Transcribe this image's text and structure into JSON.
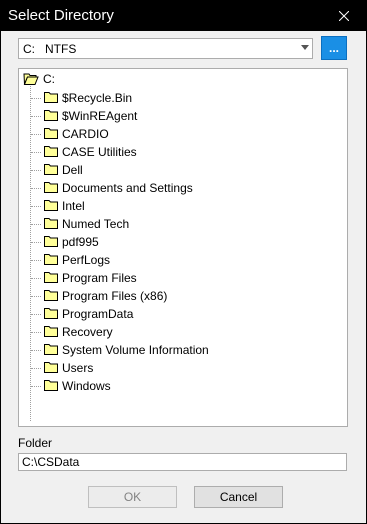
{
  "window": {
    "title": "Select Directory",
    "close_icon": "close-icon"
  },
  "drive": {
    "letter": "C:",
    "filesystem": "NTFS",
    "browse_label": "..."
  },
  "tree": {
    "root": "C:",
    "items": [
      "$Recycle.Bin",
      "$WinREAgent",
      "CARDIO",
      "CASE Utilities",
      "Dell",
      "Documents and Settings",
      "Intel",
      "Numed Tech",
      "pdf995",
      "PerfLogs",
      "Program Files",
      "Program Files (x86)",
      "ProgramData",
      "Recovery",
      "System Volume Information",
      "Users",
      "Windows"
    ]
  },
  "folder": {
    "label": "Folder",
    "value": "C:\\CSData"
  },
  "buttons": {
    "ok": "OK",
    "cancel": "Cancel"
  },
  "colors": {
    "accent": "#1a8fe5",
    "folder_fill": "#ffff99",
    "folder_outline": "#000000"
  }
}
